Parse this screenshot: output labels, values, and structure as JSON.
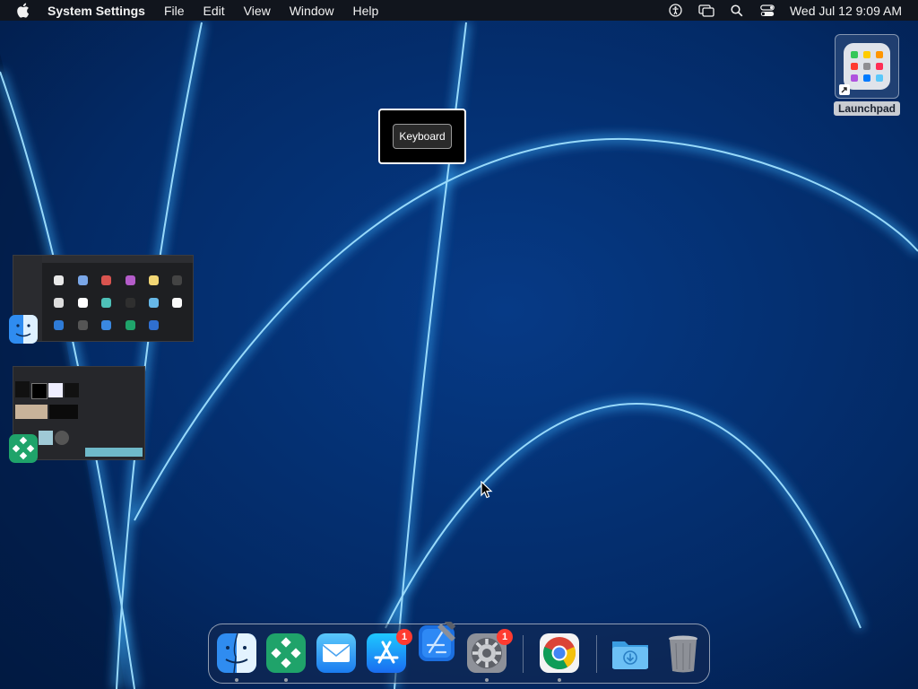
{
  "menubar": {
    "app_name": "System Settings",
    "menus": [
      "File",
      "Edit",
      "View",
      "Window",
      "Help"
    ],
    "status_icons": [
      "accessibility-icon",
      "screen-mirroring-icon",
      "spotlight-search-icon",
      "control-center-icon"
    ],
    "clock": "Wed Jul 12  9:09 AM"
  },
  "desktop": {
    "launchpad_label": "Launchpad"
  },
  "tooltip": {
    "label": "Keyboard"
  },
  "dock": {
    "items": [
      {
        "name": "Finder",
        "icon": "finder-icon",
        "running": true
      },
      {
        "name": "Sketch App",
        "icon": "green-diamond-app-icon",
        "running": true
      },
      {
        "name": "Mail",
        "icon": "mail-icon",
        "running": false
      },
      {
        "name": "App Store",
        "icon": "app-store-icon",
        "badge": "1",
        "running": false
      },
      {
        "name": "Xcode",
        "icon": "xcode-icon",
        "running": false
      },
      {
        "name": "System Settings",
        "icon": "gear-icon",
        "badge": "1",
        "running": true
      },
      {
        "name": "Google Chrome",
        "icon": "chrome-icon",
        "running": true
      },
      {
        "name": "Downloads",
        "icon": "downloads-folder-icon",
        "running": false
      },
      {
        "name": "Trash",
        "icon": "trash-icon",
        "running": false
      }
    ]
  },
  "colors": {
    "wallpaper_base": "#04245a",
    "wallpaper_glow": "#2fa8ff",
    "menubar_bg": "#11151d",
    "badge": "#ff3b30"
  }
}
